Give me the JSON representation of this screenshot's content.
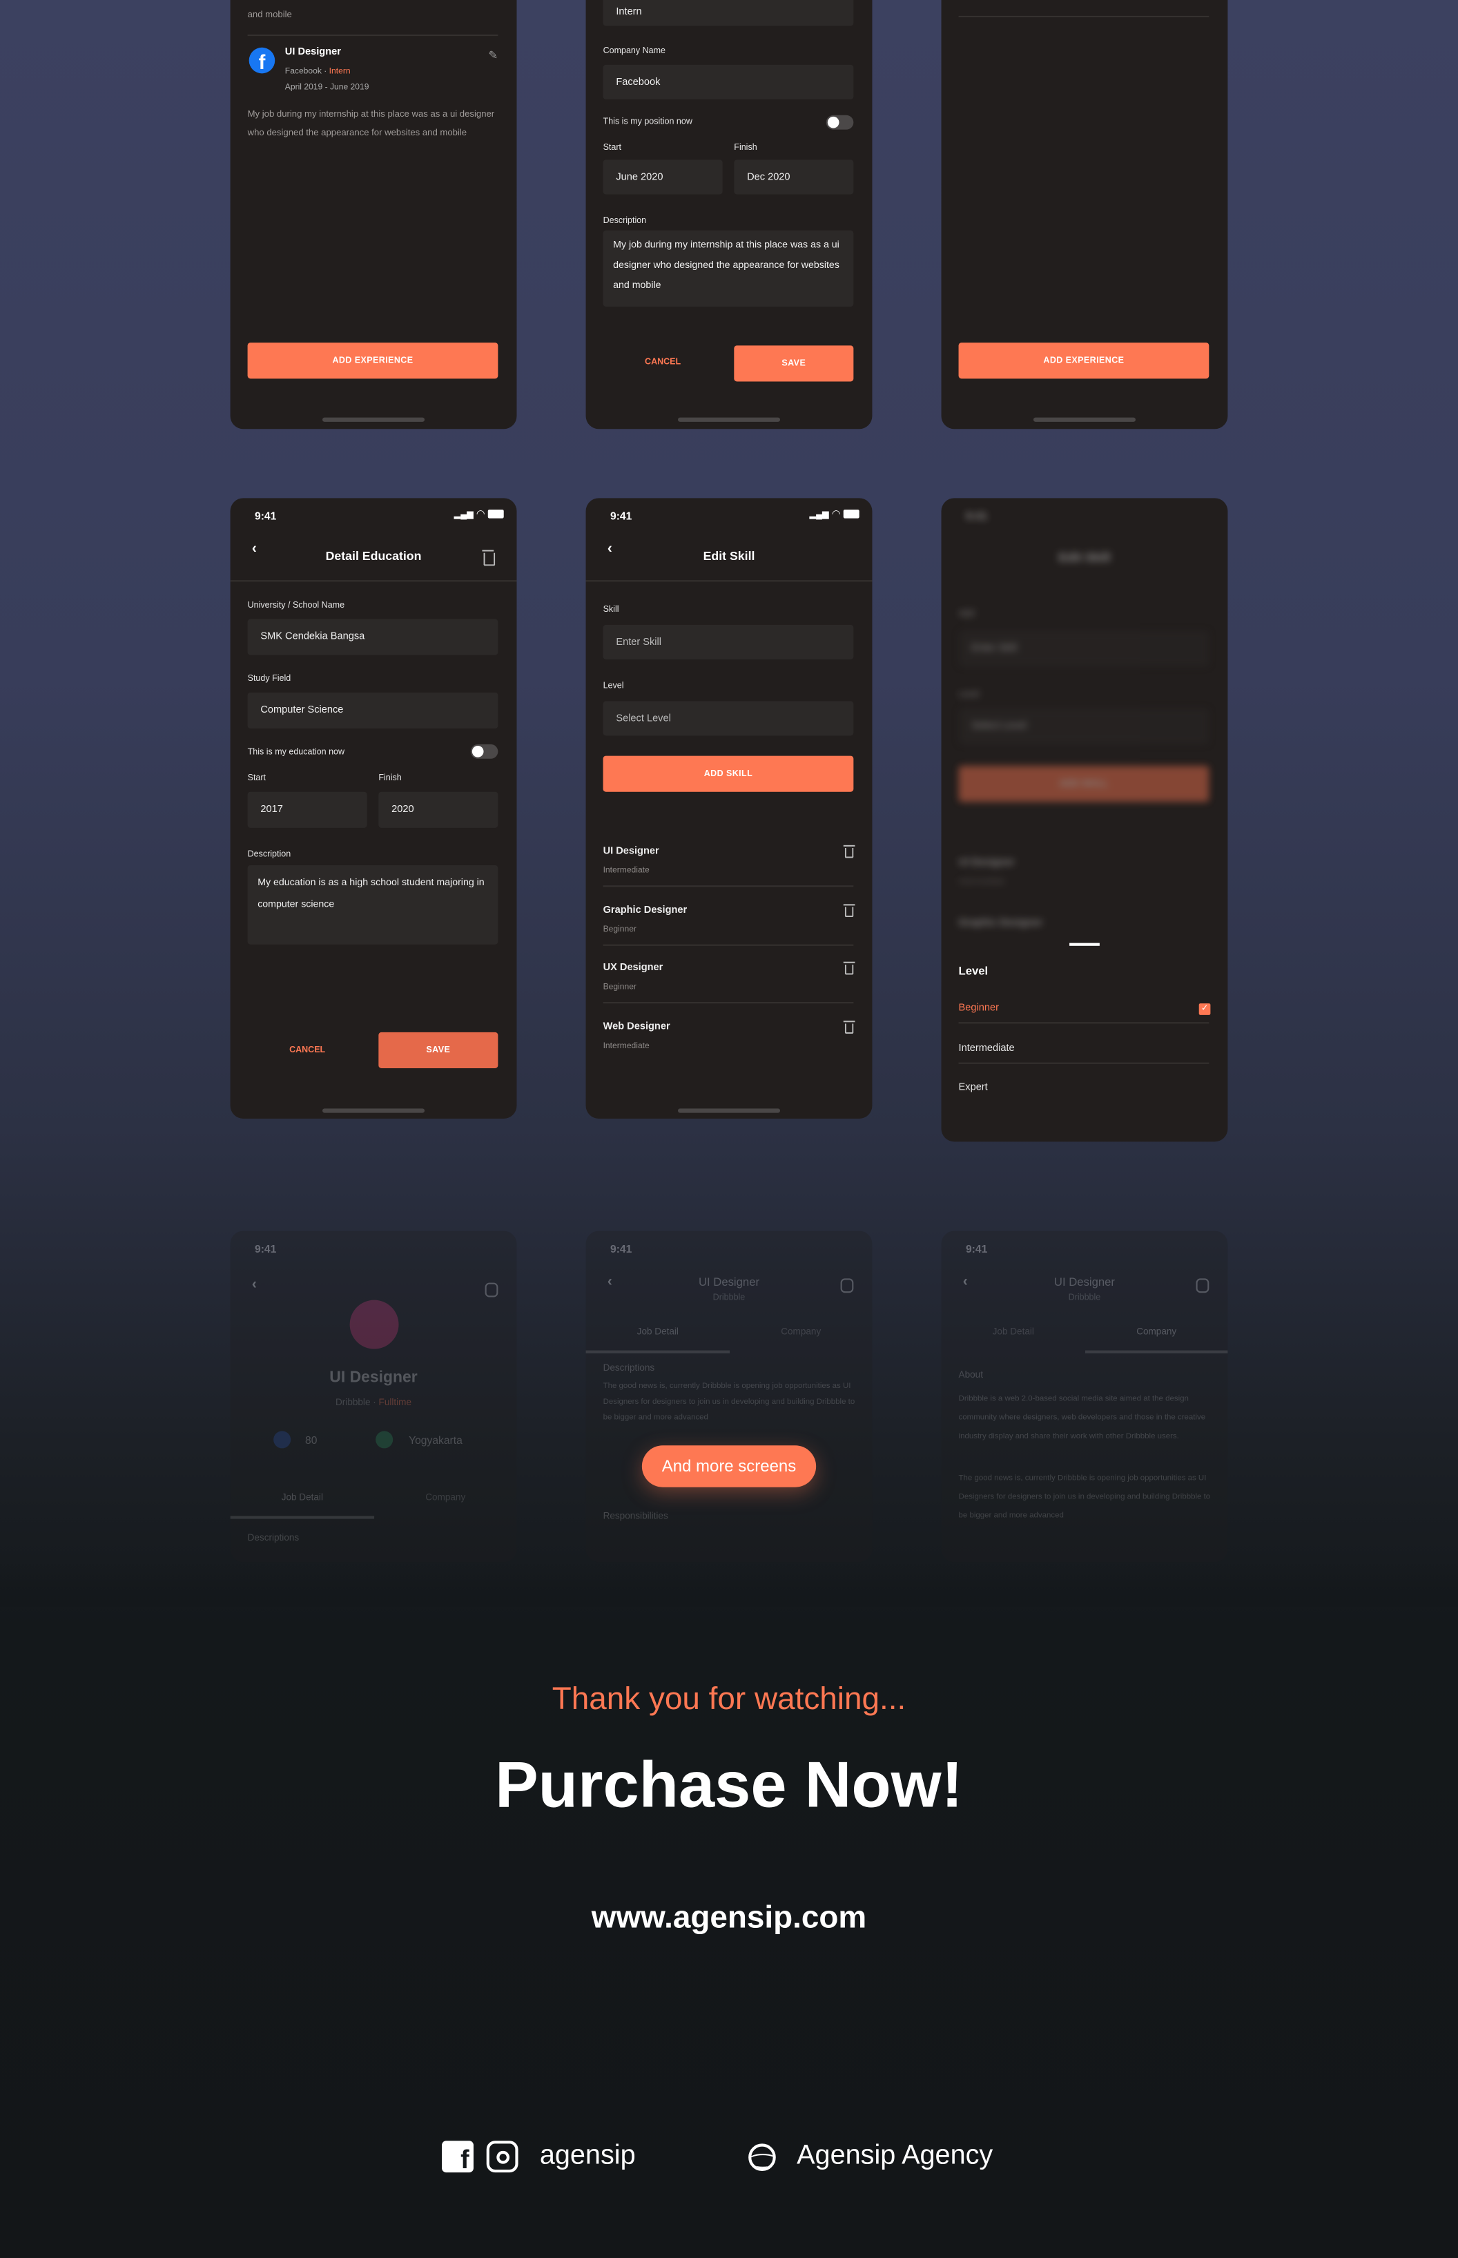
{
  "status_time": "9:41",
  "colors": {
    "accent": "#fe7853",
    "phone_bg": "#221e1d",
    "field_bg": "#2c2928"
  },
  "row1": {
    "exp_list": {
      "prev_desc_tail": "and mobile",
      "item": {
        "title": "UI Designer",
        "company": "Facebook",
        "dot": " · ",
        "type": "Intern",
        "period": "April 2019 - June 2019",
        "desc": "My job during my internship at this place was as a ui designer who designed the appearance for websites and mobile"
      },
      "add_button": "ADD EXPERIENCE"
    },
    "exp_edit": {
      "type_value": "Intern",
      "company_label": "Company Name",
      "company_value": "Facebook",
      "toggle_label": "This is my position now",
      "toggle_on": false,
      "start_label": "Start",
      "finish_label": "Finish",
      "start_value": "June 2020",
      "finish_value": "Dec 2020",
      "desc_label": "Description",
      "desc_value": "My job during my internship at this place was as a ui designer who designed the appearance for websites and mobile",
      "cancel": "CANCEL",
      "save": "SAVE"
    },
    "exp_empty": {
      "add_button": "ADD EXPERIENCE"
    }
  },
  "row2": {
    "education": {
      "title": "Detail Education",
      "school_label": "University / School Name",
      "school_value": "SMK Cendekia Bangsa",
      "field_label": "Study Field",
      "field_value": "Computer Science",
      "toggle_label": "This is my education now",
      "toggle_on": false,
      "start_label": "Start",
      "finish_label": "Finish",
      "start_value": "2017",
      "finish_value": "2020",
      "desc_label": "Description",
      "desc_value": "My education is as a high school student majoring in computer science",
      "cancel": "CANCEL",
      "save": "SAVE"
    },
    "skill": {
      "title": "Edit Skill",
      "skill_label": "Skill",
      "skill_placeholder": "Enter Skill",
      "level_label": "Level",
      "level_placeholder": "Select Level",
      "add_button": "ADD SKILL",
      "skills": [
        {
          "name": "UI Designer",
          "level": "Intermediate"
        },
        {
          "name": "Graphic Designer",
          "level": "Beginner"
        },
        {
          "name": "UX Designer",
          "level": "Beginner"
        },
        {
          "name": "Web Designer",
          "level": "Intermediate"
        }
      ]
    },
    "level_sheet": {
      "title": "Level",
      "options": [
        {
          "label": "Beginner",
          "selected": true
        },
        {
          "label": "Intermediate",
          "selected": false
        },
        {
          "label": "Expert",
          "selected": false
        }
      ]
    }
  },
  "row3": {
    "job": {
      "title": "UI Designer",
      "company": "Dribbble",
      "type": "Fulltime",
      "applicants": "80",
      "location": "Yogyakarta",
      "tabs": [
        "Job Detail",
        "Company"
      ],
      "section": "Descriptions"
    },
    "job_detail": {
      "title": "UI Designer",
      "company": "Dribbble",
      "tabs": [
        "Job Detail",
        "Company"
      ],
      "section": "Descriptions",
      "text": "The good news is, currently Dribbble is opening job opportunities as UI Designers for designers to join us in developing and building Dribbble to be bigger and more advanced",
      "section2": "Responsibilities"
    },
    "company": {
      "title": "UI Designer",
      "company": "Dribbble",
      "tabs": [
        "Job Detail",
        "Company"
      ],
      "section": "About",
      "text": "Dribbble is a web 2.0-based social media site aimed at the design community where designers, web developers and those in the creative industry display and share their work with other Dribbble users.",
      "text2": "The good news is, currently Dribbble is opening job opportunities as UI Designers for designers to join us in developing and building Dribbble to be bigger and more advanced"
    }
  },
  "more_button": "And more screens",
  "thanks": "Thank you for watching...",
  "cta": "Purchase Now!",
  "website": "www.agensip.com",
  "footer": {
    "social_handle": "agensip",
    "dribbble_name": "Agensip Agency",
    "icons": [
      "facebook-icon",
      "instagram-icon",
      "dribbble-icon"
    ]
  }
}
